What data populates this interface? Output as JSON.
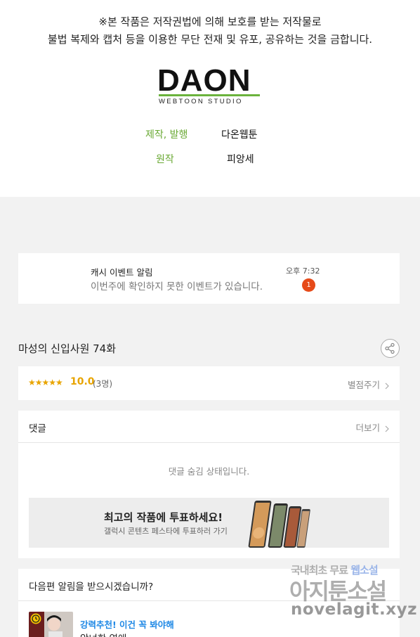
{
  "copyright": {
    "line1": "※본 작품은 저작권법에 의해 보호를 받는 저작물로",
    "line2": "불법 복제와 캡처 등을 이용한 무단 전재 및 유포, 공유하는 것을 금합니다."
  },
  "logo": {
    "name": "DAON",
    "subtitle": "WEBTOON STUDIO"
  },
  "credits": [
    {
      "role": "제작, 발행",
      "value": "다온웹툰"
    },
    {
      "role": "원작",
      "value": "피앙세"
    }
  ],
  "event": {
    "title": "캐시 이벤트 알림",
    "description": "이번주에 확인하지 못한 이벤트가 있습니다.",
    "time": "오후 7:32",
    "badge": "1"
  },
  "episode": {
    "title": "마성의 신입사원 74화"
  },
  "rating": {
    "stars": "★★★★★",
    "score": "10.0",
    "count": "(3명)",
    "rate_button": "별점주기"
  },
  "comments": {
    "title": "댓글",
    "more": "더보기",
    "hidden_message": "댓글 숨김 상태입니다."
  },
  "banner": {
    "title": "최고의 작품에 투표하세요!",
    "subtitle": "갤럭시 콘텐츠 페스타에 투표하러 가기"
  },
  "next_alert": {
    "title": "다음편 알림을 받으시겠습니까?",
    "recommend_tag": "강력추천! 이건 꼭 봐야해",
    "recommend_title": "악녀한 연애"
  },
  "watermark": {
    "line1a": "국내최초 무료 ",
    "line1b": "웹소설",
    "line2": "아지툰소설",
    "line3": "novelagit.xyz"
  },
  "colors": {
    "accent_green": "#6aa934",
    "star": "#e8a400",
    "badge": "#e64a19",
    "link_blue": "#1e88e5"
  },
  "icons": [
    "share-icon",
    "chevron-right-icon",
    "clock-icon"
  ]
}
